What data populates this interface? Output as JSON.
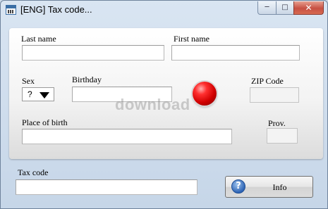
{
  "window": {
    "title": "[ENG] Tax code...",
    "min_glyph": "─",
    "max_glyph": "□",
    "close_glyph": "✕"
  },
  "form": {
    "last_name_label": "Last name",
    "first_name_label": "First name",
    "sex_label": "Sex",
    "sex_value": "?",
    "birthday_label": "Birthday",
    "zip_label": "ZIP Code",
    "place_of_birth_label": "Place of birth",
    "prov_label": "Prov.",
    "status_light_color": "#e00000"
  },
  "watermark": "download",
  "footer": {
    "tax_code_label": "Tax code",
    "info_button_label": "Info",
    "info_icon_glyph": "?"
  }
}
